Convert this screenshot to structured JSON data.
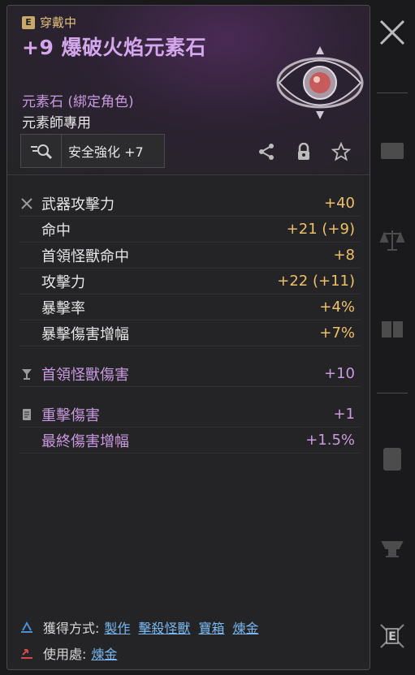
{
  "header": {
    "equip_badge": "E",
    "equip_status": "穿戴中",
    "title": "+9 爆破火焰元素石",
    "item_type": "元素石 (綁定角色)",
    "class_requirement": "元素師專用",
    "safe_enhance_label": "安全強化 +7"
  },
  "stats_group1": [
    {
      "name": "武器攻擊力",
      "value": "+40"
    },
    {
      "name": "命中",
      "value": "+21",
      "extra": "(+9)"
    },
    {
      "name": "首領怪獸命中",
      "value": "+8"
    },
    {
      "name": "攻擊力",
      "value": "+22",
      "extra": "(+11)"
    },
    {
      "name": "暴擊率",
      "value": "+4%"
    },
    {
      "name": "暴擊傷害增幅",
      "value": "+7%"
    }
  ],
  "stats_group2": [
    {
      "name": "首領怪獸傷害",
      "value": "+10"
    }
  ],
  "stats_group3": [
    {
      "name": "重擊傷害",
      "value": "+1"
    },
    {
      "name": "最終傷害增幅",
      "value": "+1.5%"
    }
  ],
  "footer": {
    "obtain_label": "獲得方式:",
    "obtain_links": [
      "製作",
      "擊殺怪獸",
      "寶箱",
      "煉金"
    ],
    "use_label": "使用處:",
    "use_links": [
      "煉金"
    ]
  },
  "sidebar": {
    "e_label": "E"
  },
  "colors": {
    "title_purple": "#d4a6ec",
    "value_gold": "#eec06a",
    "link_blue": "#7ab8f2",
    "equip_gold": "#e3c27d"
  }
}
